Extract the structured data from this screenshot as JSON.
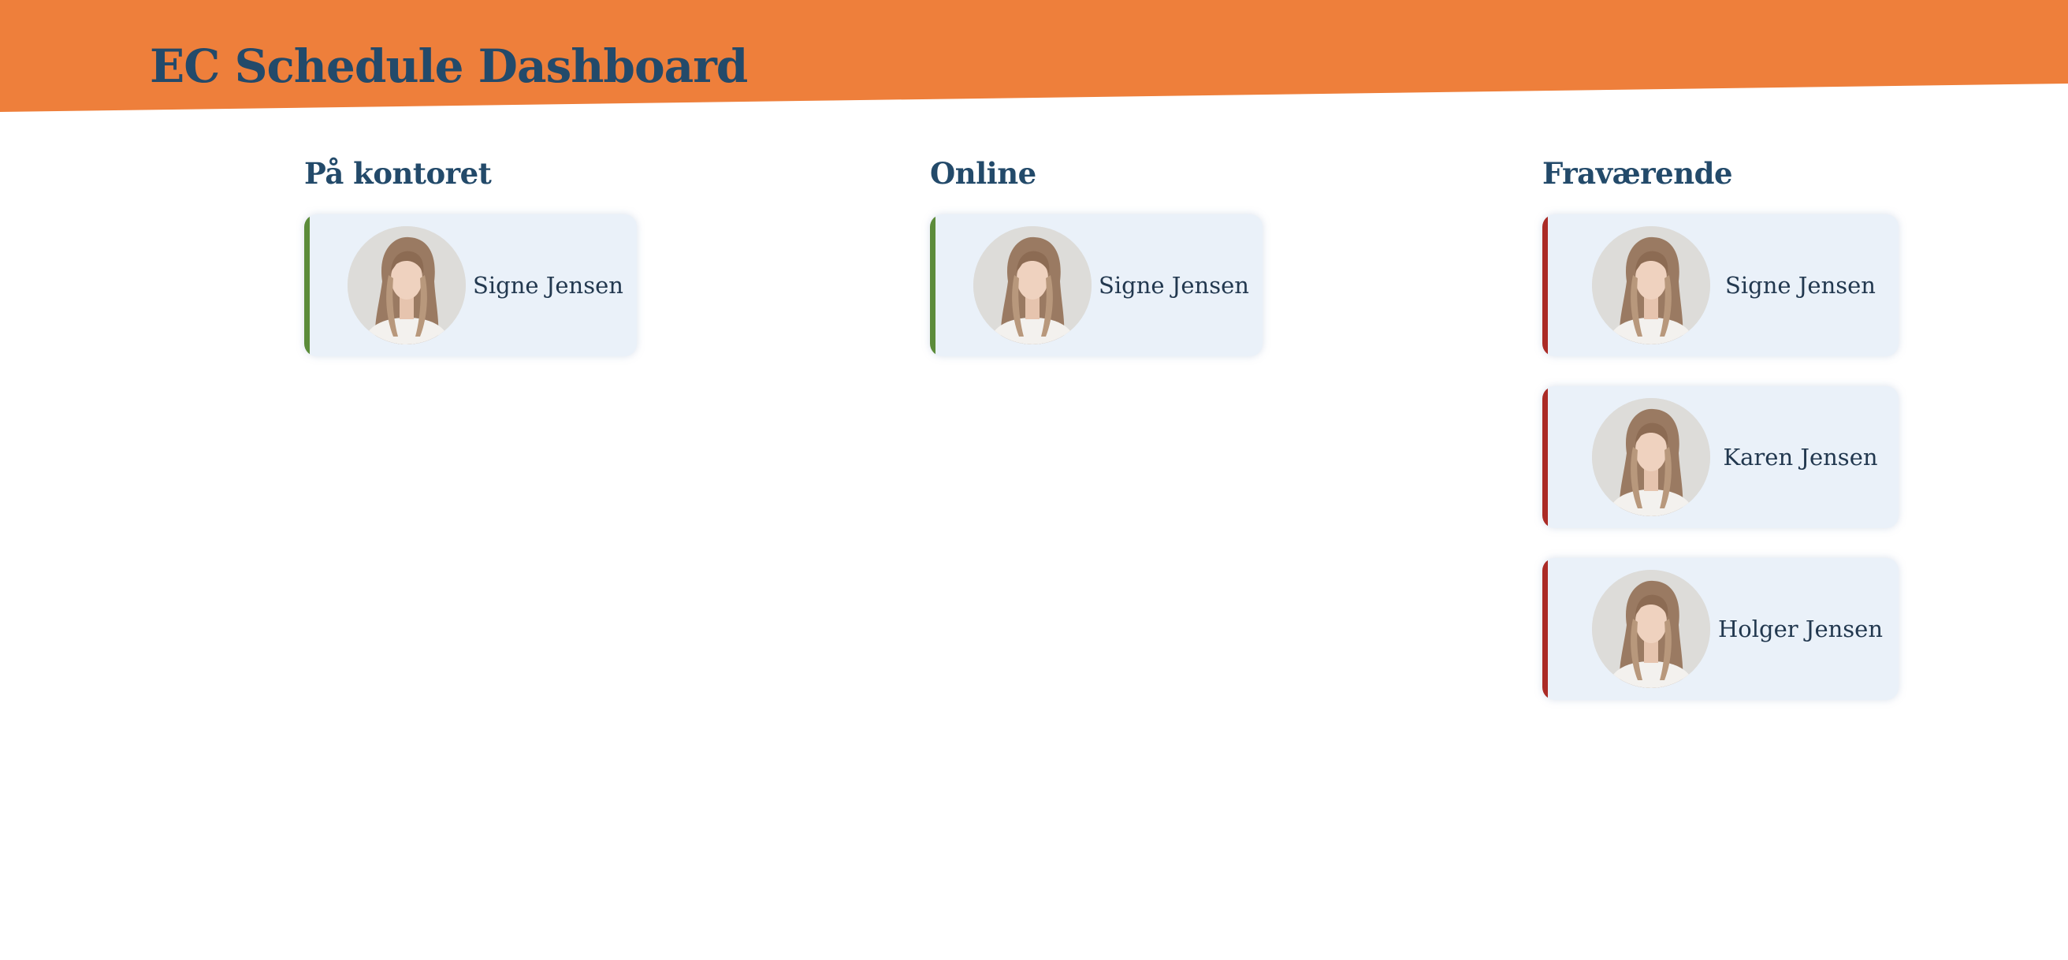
{
  "header": {
    "title": "EC Schedule Dashboard",
    "background_color": "#ee7f3b",
    "title_color": "#234a6a"
  },
  "columns": [
    {
      "title": "På kontoret",
      "status": "office",
      "accent_color": "#5c8c3a",
      "people": [
        {
          "name": "Signe Jensen",
          "avatar": "portrait-photo"
        }
      ]
    },
    {
      "title": "Online",
      "status": "online",
      "accent_color": "#5c8c3a",
      "people": [
        {
          "name": "Signe Jensen",
          "avatar": "portrait-photo"
        }
      ]
    },
    {
      "title": "Fraværende",
      "status": "absent",
      "accent_color": "#ab2b26",
      "people": [
        {
          "name": "Signe Jensen",
          "avatar": "portrait-photo"
        },
        {
          "name": "Karen Jensen",
          "avatar": "portrait-photo"
        },
        {
          "name": "Holger Jensen",
          "avatar": "portrait-photo"
        }
      ]
    }
  ]
}
